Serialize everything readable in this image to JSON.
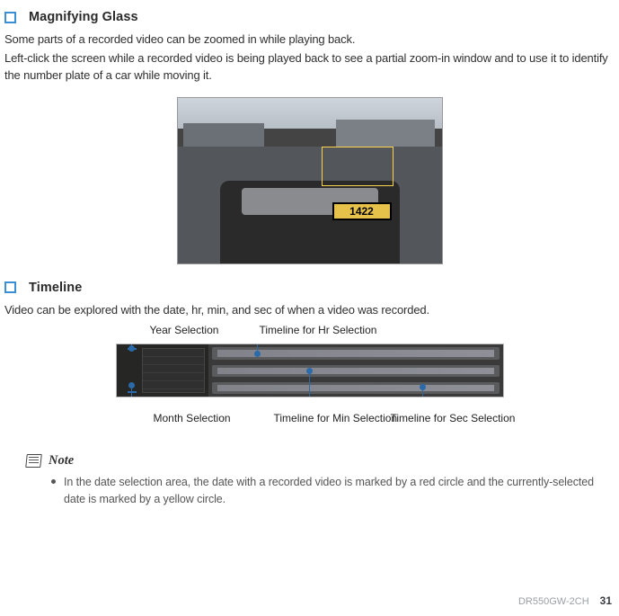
{
  "sections": {
    "magnifying_glass": {
      "title": "Magnifying Glass",
      "para1": "Some parts of a recorded video can be zoomed in while playing back.",
      "para2": "Left-click the screen while a recorded video is being played back to see a partial zoom-in window and to use it to identify the number plate of a car while moving it."
    },
    "timeline": {
      "title": "Timeline",
      "intro": "Video can be explored with the date, hr, min, and sec of when a video was recorded.",
      "labels": {
        "year": "Year Selection",
        "month": "Month Selection",
        "hr": "Timeline for Hr Selection",
        "min": "Timeline for Min Selection",
        "sec": "Timeline for Sec Selection"
      }
    }
  },
  "screenshot": {
    "plate_text": "1422"
  },
  "note": {
    "title": "Note",
    "items": [
      "In the date selection area, the date with a recorded video is marked by a red circle and the currently-selected date is marked by a yellow circle."
    ]
  },
  "footer": {
    "model": "DR550GW-2CH",
    "page": "31"
  }
}
